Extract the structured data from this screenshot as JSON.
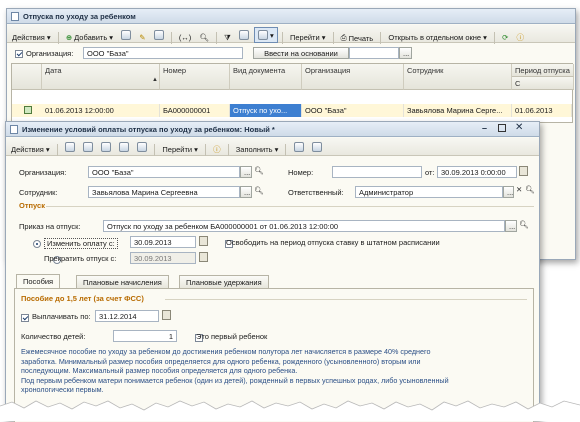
{
  "list_window": {
    "title": "Отпуска по уходу за ребенком",
    "toolbar": {
      "actions": "Действия",
      "add": "Добавить",
      "goto": "Перейти",
      "print": "Печать",
      "open_separate": "Открыть в отдельном окне"
    },
    "filter": {
      "org_label": "Организация:",
      "org_value": "ООО \"База\"",
      "enter_based": "Ввести на основании"
    },
    "columns": [
      "Дата",
      "Номер",
      "Вид документа",
      "Организация",
      "Сотрудник",
      "Период отпуска",
      "С"
    ],
    "row": {
      "date": "01.06.2013 12:00:00",
      "number": "БА000000001",
      "doc_type": "Отпуск по ухо...",
      "org": "ООО \"База\"",
      "employee": "Завьялова Марина Серге...",
      "period": "01.06.2013"
    }
  },
  "edit_window": {
    "title": "Изменение условий оплаты отпуска по уходу за ребенком: Новый *",
    "toolbar": {
      "actions": "Действия",
      "goto": "Перейти",
      "fill": "Заполнить"
    },
    "org_label": "Организация:",
    "org_value": "ООО \"База\"",
    "number_label": "Номер:",
    "date_from_label": "от:",
    "date_value": "30.09.2013 0:00:00",
    "employee_label": "Сотрудник:",
    "employee_value": "Завьялова Марина Сергеевна",
    "responsible_label": "Ответственный:",
    "responsible_value": "Администратор",
    "section_leave": "Отпуск",
    "order_label": "Приказ на отпуск:",
    "order_value": "Отпуск по уходу за ребенком БА000000001 от 01.06.2013 12:00:00",
    "change_pay_label": "Изменить оплату с:",
    "change_pay_value": "30.09.2013",
    "free_rate_label": "Освободить на период отпуска ставку в штатном расписании",
    "stop_leave_label": "Прекратить отпуск с:",
    "stop_leave_value": "30.09.2013",
    "tabs": [
      "Пособия",
      "Плановые начисления",
      "Плановые удержания"
    ],
    "benefit_header": "Пособие до 1,5 лет (за счет ФСС)",
    "pay_until_label": "Выплачивать по:",
    "pay_until_value": "31.12.2014",
    "children_label": "Количество детей:",
    "children_value": "1",
    "first_child_label": "Это первый ребенок",
    "info_lines": [
      "Ежемесячное пособие по уходу за ребенком до достижения ребенком полутора лет начисляется в размере 40% среднего",
      "заработка. Минимальный размер пособия определяется для одного ребенка, рожденного (усыновленного) вторым или",
      "последующим. Максимальный размер пособия определяется для одного ребенка.",
      "Под первым ребенком матери понимается ребенок (один из детей), рожденный в первых успешных родах, либо усыновленный",
      "хронологически первым."
    ]
  }
}
